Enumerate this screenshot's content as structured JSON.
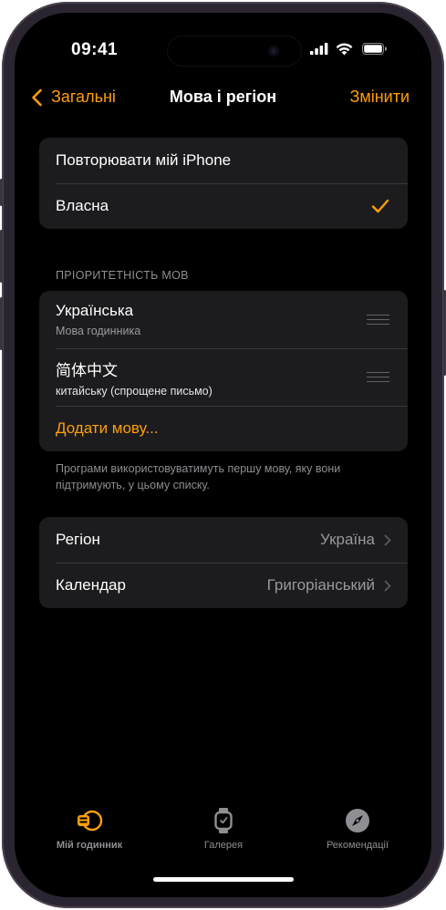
{
  "status_bar": {
    "time": "09:41"
  },
  "nav": {
    "back_label": "Загальні",
    "title": "Мова і регіон",
    "edit_label": "Змінити"
  },
  "mode_group": {
    "items": [
      {
        "label": "Повторювати мій iPhone",
        "selected": false
      },
      {
        "label": "Власна",
        "selected": true
      }
    ]
  },
  "languages": {
    "header": "ПРІОРИТЕТНІСТЬ МОВ",
    "items": [
      {
        "name": "Українська",
        "subtitle": "Мова годинника"
      },
      {
        "name": "简体中文",
        "subtitle": "китайську (спрощене письмо)"
      }
    ],
    "add_label": "Додати мову...",
    "footnote": "Програми використовуватимуть першу мову, яку вони підтримують, у цьому списку."
  },
  "region_group": {
    "items": [
      {
        "label": "Регіон",
        "value": "Україна"
      },
      {
        "label": "Календар",
        "value": "Григоріанський"
      }
    ]
  },
  "tabbar": {
    "items": [
      {
        "label": "Мій годинник",
        "icon": "watch-face-icon",
        "active": true
      },
      {
        "label": "Галерея",
        "icon": "watch-icon",
        "active": false
      },
      {
        "label": "Рекомендації",
        "icon": "compass-icon",
        "active": false
      }
    ]
  },
  "colors": {
    "accent": "#ff9f0a",
    "background": "#000000",
    "group": "#1c1c1e",
    "secondary_text": "#8e8e93"
  }
}
